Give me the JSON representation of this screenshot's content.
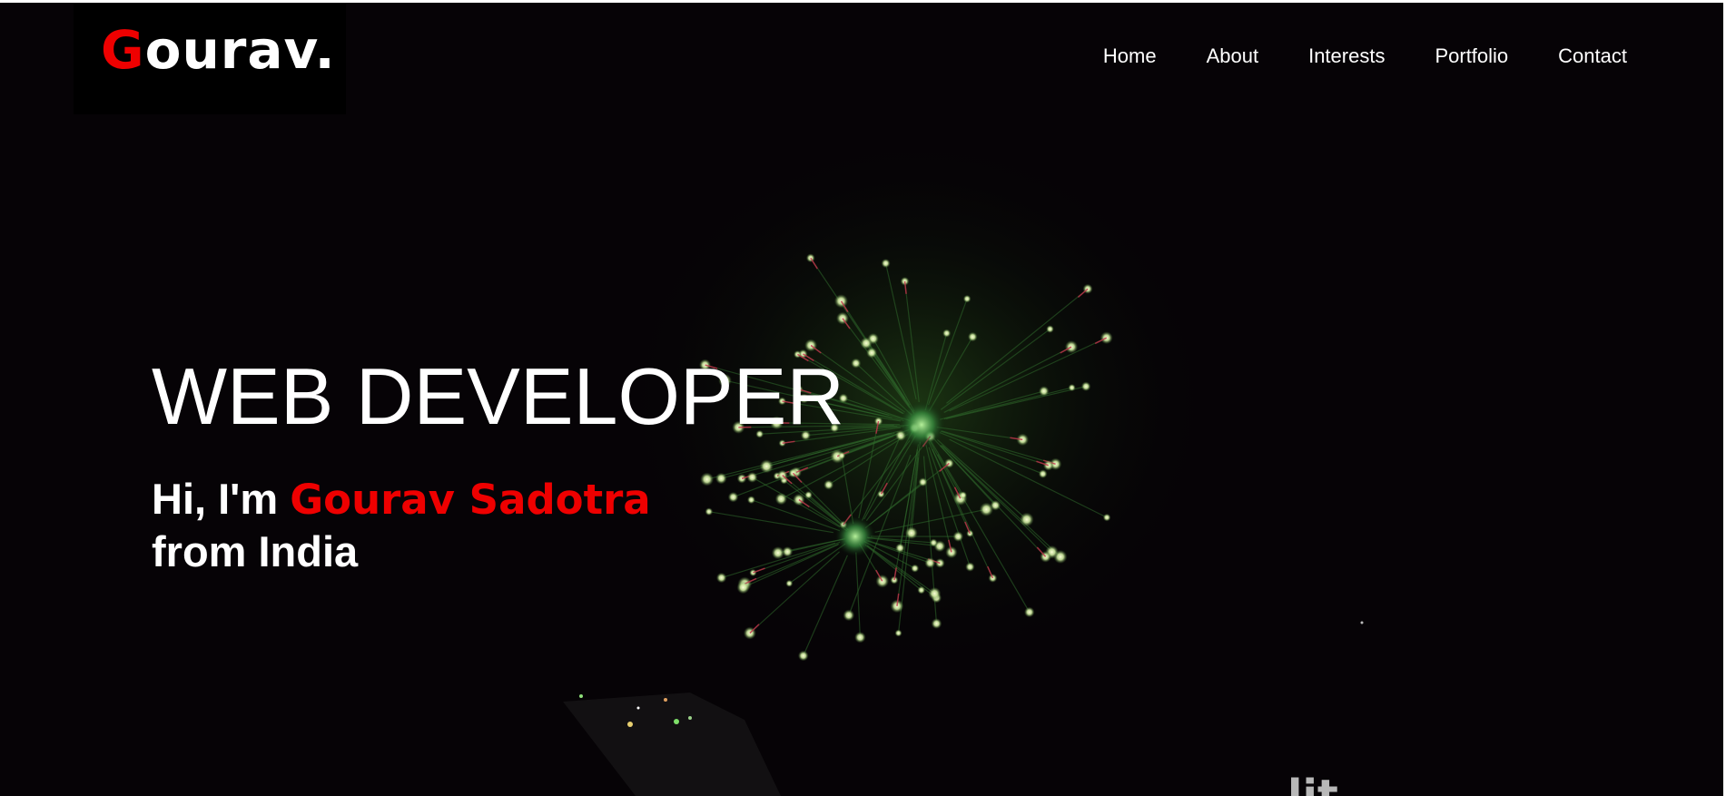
{
  "brand": {
    "logo_initial": "G",
    "logo_rest": "ourav.",
    "accent_color": "#ee0000"
  },
  "nav": {
    "items": [
      {
        "label": "Home"
      },
      {
        "label": "About"
      },
      {
        "label": "Interests"
      },
      {
        "label": "Portfolio"
      },
      {
        "label": "Contact"
      }
    ]
  },
  "hero": {
    "title": "WEB DEVELOPER",
    "greeting": "Hi, I'm",
    "name": "Gourav Sadotra",
    "origin": "from India",
    "background": "night-fireworks-video"
  },
  "partial_text": "lit"
}
